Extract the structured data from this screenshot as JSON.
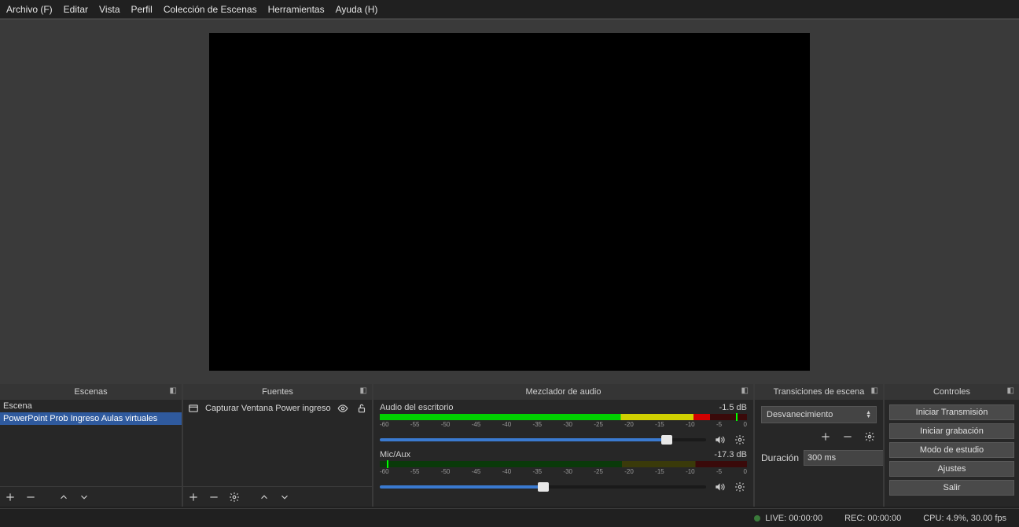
{
  "menu": [
    "Archivo (F)",
    "Editar",
    "Vista",
    "Perfil",
    "Colección de Escenas",
    "Herramientas",
    "Ayuda (H)"
  ],
  "docks": {
    "scenes": {
      "title": "Escenas",
      "items": [
        "Escena",
        "PowerPoint Prob Ingreso Aulas virtuales"
      ],
      "selected": 1
    },
    "sources": {
      "title": "Fuentes",
      "items": [
        {
          "label": "Capturar Ventana Power ingreso aulas"
        }
      ]
    },
    "mixer": {
      "title": "Mezclador de audio",
      "ticks": [
        "-60",
        "-55",
        "-50",
        "-45",
        "-40",
        "-35",
        "-30",
        "-25",
        "-20",
        "-15",
        "-10",
        "-5",
        "0"
      ],
      "channels": [
        {
          "name": "Audio del escritorio",
          "db": "-1.5 dB",
          "level": 90,
          "peak": 97,
          "slider": 88
        },
        {
          "name": "Mic/Aux",
          "db": "-17.3 dB",
          "level": 0,
          "peak": 2,
          "slider": 50
        }
      ]
    },
    "transitions": {
      "title": "Transiciones de escena",
      "selected": "Desvanecimiento",
      "durationLabel": "Duración",
      "duration": "300 ms"
    },
    "controls": {
      "title": "Controles",
      "buttons": [
        "Iniciar Transmisión",
        "Iniciar grabación",
        "Modo de estudio",
        "Ajustes",
        "Salir"
      ]
    }
  },
  "status": {
    "live": "LIVE: 00:00:00",
    "rec": "REC: 00:00:00",
    "cpu": "CPU: 4.9%, 30.00 fps"
  }
}
